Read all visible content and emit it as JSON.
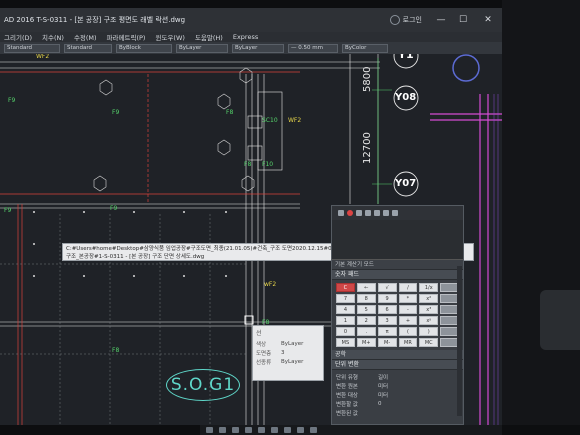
{
  "window": {
    "title": "AD 2016   T-S-0311 - [본 공장] 구조 평면도 래벨 락션.dwg",
    "user_label": "로그인",
    "minimize": "—",
    "maximize": "☐",
    "close": "✕"
  },
  "menu": [
    "그리기(D)",
    "치수(N)",
    "수정(M)",
    "파라메트릭(P)",
    "윈도우(W)",
    "도움말(H)",
    "Express"
  ],
  "toolbar": {
    "style_combo": "Standard",
    "dim_combo": "Standard",
    "layer_combo": "ByBlock",
    "color_combo": "ByLayer",
    "linetype_combo": "ByLayer",
    "lineweight_combo": "— 0.50 mm",
    "plot_combo": "ByColor"
  },
  "drawing": {
    "dim_5800": "5800",
    "dim_12700": "12700",
    "grid_y1": "Y1",
    "grid_y08": "Y08",
    "grid_y07": "Y07",
    "wf2_top": "WF2",
    "wf2_mid": "wF2",
    "wf2_low": "wF2",
    "f9": "F9",
    "f8": "F8",
    "f10": "F10",
    "sc10": "SC10",
    "sc9": "SC9",
    "c3": "C3",
    "sog": "S.O.G1"
  },
  "tooltip": {
    "line1": "C:#Users#home#Desktop#삼양식품      임업공장#구조도면_최종(21.01.05)#건축_구조 도면2020.12.15#01 건축구조#01 도면#01 CAD#02",
    "line2": "구조_본공장#1-S-0311 - [본 공장] 구조 단면 상세도.dwg"
  },
  "properties_popup": {
    "title": "선",
    "rows": [
      {
        "key": "색상",
        "value": "ByLayer"
      },
      {
        "key": "도면층",
        "value": "3"
      },
      {
        "key": "선종류",
        "value": "ByLayer"
      }
    ]
  },
  "calculator": {
    "mode_header": "기본 계산기 모드",
    "numpad_header": "숫자 패드",
    "keys": [
      "C",
      "←",
      "√",
      "/",
      "1/x",
      "",
      "7",
      "8",
      "9",
      "*",
      "x²",
      "",
      "4",
      "5",
      "6",
      "-",
      "x³",
      "",
      "1",
      "2",
      "3",
      "+",
      "xʸ",
      "",
      "0",
      ".",
      "π",
      "(",
      ")",
      "",
      "MS",
      "M+",
      "M-",
      "MR",
      "MC",
      ""
    ],
    "sci_header": "공학",
    "unit_header": "단위 변환",
    "unit_rows": [
      {
        "key": "단위 유형",
        "value": "길이"
      },
      {
        "key": "변환 원본",
        "value": "미터"
      },
      {
        "key": "변환 대상",
        "value": "미터"
      },
      {
        "key": "변환할 값",
        "value": "0"
      },
      {
        "key": "변환된 값",
        "value": ""
      }
    ]
  },
  "colors": {
    "magenta": "#d34bd3",
    "cyan": "#5fd7c9",
    "green": "#55d36b",
    "red": "#d9423b",
    "yellow": "#e6d54a"
  }
}
